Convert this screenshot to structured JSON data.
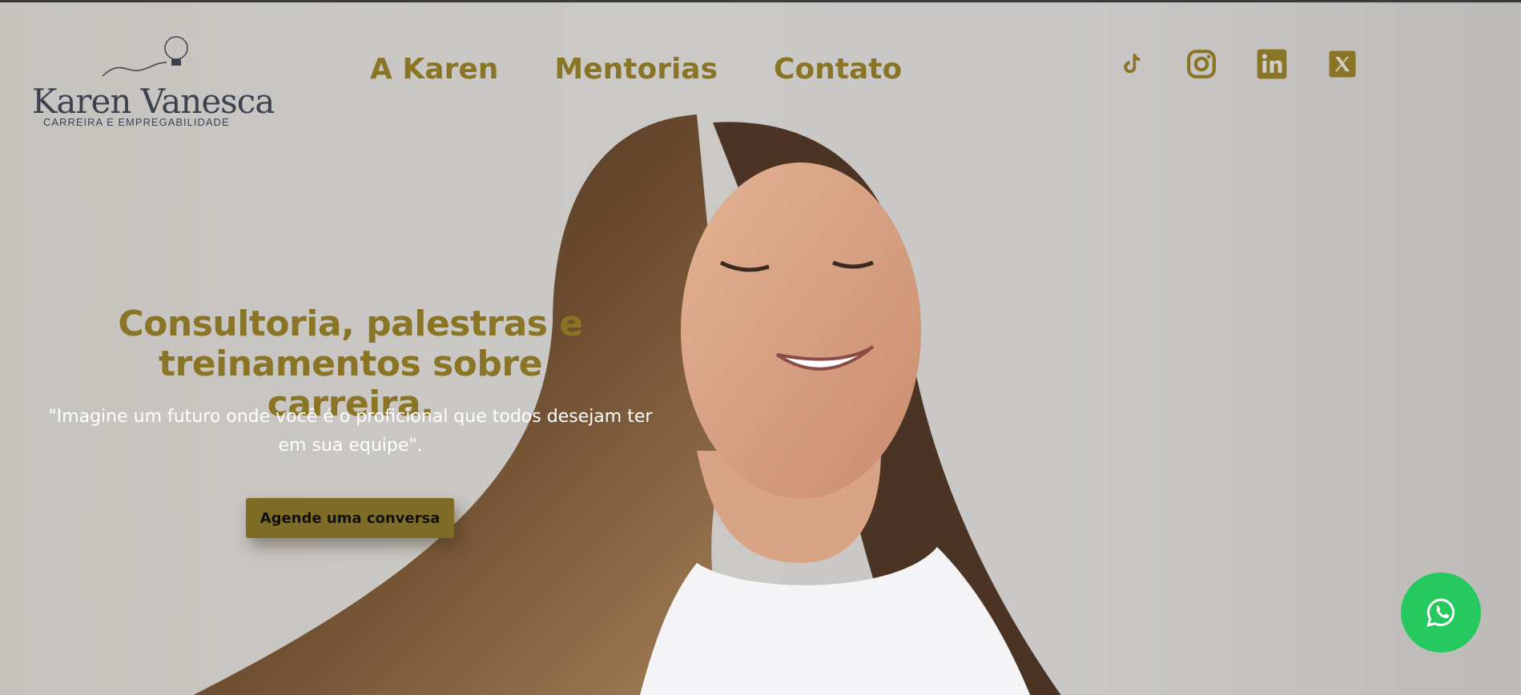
{
  "brand": {
    "name": "Karen Vanesca",
    "tagline": "CARREIRA E EMPREGABILIDADE",
    "accent_color": "#8a7426",
    "logo_color": "#3c4250"
  },
  "nav": {
    "items": [
      {
        "label": "A Karen"
      },
      {
        "label": "Mentorias"
      },
      {
        "label": "Contato"
      }
    ]
  },
  "socials": [
    {
      "icon": "tiktok-icon"
    },
    {
      "icon": "instagram-icon"
    },
    {
      "icon": "linkedin-icon"
    },
    {
      "icon": "x-icon"
    }
  ],
  "hero": {
    "headline": "Consultoria, palestras e treinamentos sobre carreira.",
    "quote": "\"Imagine um futuro onde você é o proficional que todos desejam ter em sua equipe\".",
    "cta_label": "Agende uma conversa"
  },
  "whatsapp": {
    "icon": "whatsapp-icon",
    "color": "#25c95e"
  }
}
